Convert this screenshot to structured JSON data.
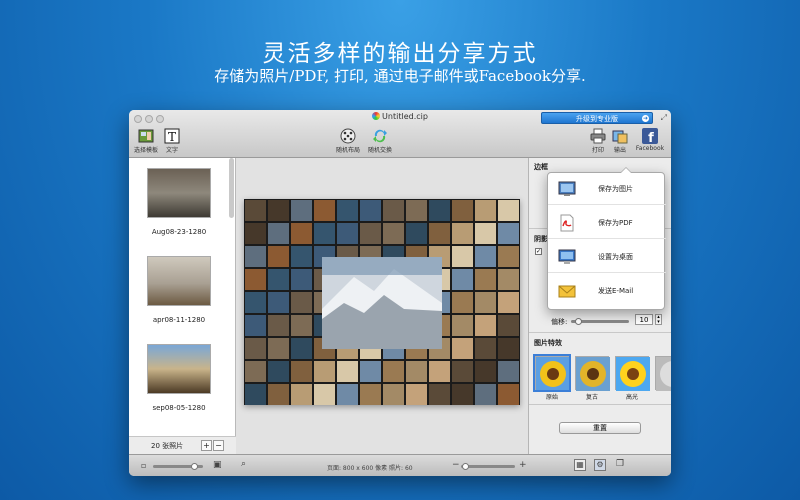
{
  "hero": {
    "title": "灵活多样的输出分享方式",
    "subtitle": "存储为照片/PDF, 打印, 通过电子邮件或Facebook分享."
  },
  "window": {
    "title": "Untitled.cip",
    "upgrade_label": "升级到专业版"
  },
  "toolbar": {
    "choose_template": "选择模板",
    "text": "文字",
    "random_layout": "随机布局",
    "random_swap": "随机交换",
    "print": "打印",
    "export": "输出",
    "facebook": "Facebook"
  },
  "sidebar": {
    "items": [
      {
        "label": "Aug08-23-1280"
      },
      {
        "label": "apr08-11-1280"
      },
      {
        "label": "sep08-05-1280"
      }
    ],
    "footer_count": "20 张照片",
    "add": "+",
    "remove": "−"
  },
  "panel": {
    "border_title": "边框",
    "shadow_title": "阴影",
    "offset_label": "偏移:",
    "offset_value": "10",
    "effects_title": "图片特效",
    "effects": [
      {
        "label": "原始"
      },
      {
        "label": "复古"
      },
      {
        "label": "高光"
      }
    ],
    "reset": "重置"
  },
  "export_menu": {
    "items": [
      {
        "label": "保存为图片",
        "icon": "image-icon"
      },
      {
        "label": "保存为PDF",
        "icon": "pdf-icon"
      },
      {
        "label": "设置为桌面",
        "icon": "desktop-icon"
      },
      {
        "label": "发送E-Mail",
        "icon": "email-icon"
      }
    ]
  },
  "statusbar": {
    "info": "页面: 800 x 600 像素 照片: 60",
    "minus": "−",
    "plus": "+"
  },
  "colors": {
    "background": "#1a78c6",
    "accent": "#1f76d0"
  }
}
